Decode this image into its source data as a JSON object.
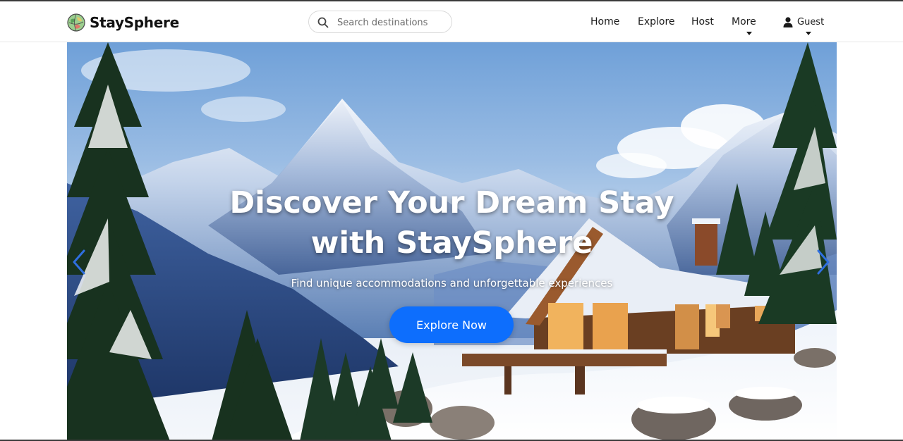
{
  "brand": {
    "name": "StaySphere",
    "logo_icon": "globe-logo-icon"
  },
  "search": {
    "placeholder": "Search destinations",
    "value": "",
    "icon": "search-icon"
  },
  "nav": {
    "items": [
      {
        "label": "Home"
      },
      {
        "label": "Explore"
      },
      {
        "label": "Host"
      },
      {
        "label": "More",
        "dropdown": true
      }
    ],
    "user": {
      "label": "Guest",
      "icon": "user-icon",
      "dropdown": true
    }
  },
  "hero": {
    "title_line1": "Discover Your Dream Stay",
    "title_line2": "with StaySphere",
    "subtitle": "Find unique accommodations and unforgettable experiences",
    "cta_label": "Explore Now",
    "prev_icon": "chevron-left-icon",
    "next_icon": "chevron-right-icon"
  },
  "colors": {
    "accent": "#0d6efd",
    "text": "#1a1a1a",
    "navbar_bg": "#ffffff"
  }
}
